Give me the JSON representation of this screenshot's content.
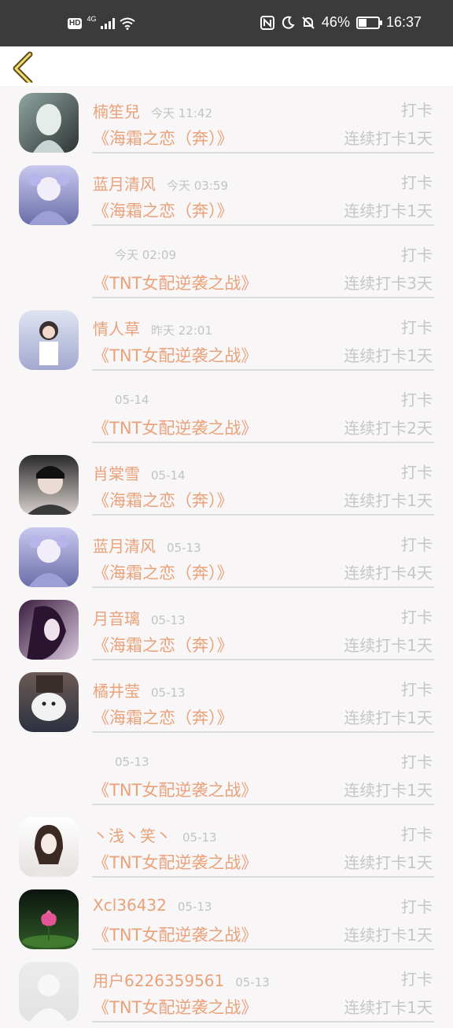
{
  "status_bar": {
    "hd": "HD",
    "network": "4G",
    "battery_percent": "46%",
    "battery_level": 0.46,
    "time": "16:37"
  },
  "header": {
    "back_icon": "chevron-left-icon"
  },
  "records": [
    {
      "name": "楠笙兒",
      "time": "今天 11:42",
      "action": "打卡",
      "book": "《海霜之恋（奔）》",
      "streak": "连续打卡1天",
      "avatar": "a1"
    },
    {
      "name": "蓝月清风",
      "time": "今天 03:59",
      "action": "打卡",
      "book": "《海霜之恋（奔）》",
      "streak": "连续打卡1天",
      "avatar": "a2"
    },
    {
      "name": "",
      "time": "今天 02:09",
      "action": "打卡",
      "book": "《TNT女配逆袭之战》",
      "streak": "连续打卡3天",
      "avatar": ""
    },
    {
      "name": "情人草",
      "time": "昨天 22:01",
      "action": "打卡",
      "book": "《TNT女配逆袭之战》",
      "streak": "连续打卡1天",
      "avatar": "a3"
    },
    {
      "name": "",
      "time": "05-14",
      "action": "打卡",
      "book": "《TNT女配逆袭之战》",
      "streak": "连续打卡2天",
      "avatar": ""
    },
    {
      "name": "肖棠雪",
      "time": "05-14",
      "action": "打卡",
      "book": "《海霜之恋（奔）》",
      "streak": "连续打卡1天",
      "avatar": "a4"
    },
    {
      "name": "蓝月清风",
      "time": "05-13",
      "action": "打卡",
      "book": "《海霜之恋（奔）》",
      "streak": "连续打卡4天",
      "avatar": "a2"
    },
    {
      "name": "月音璃",
      "time": "05-13",
      "action": "打卡",
      "book": "《海霜之恋（奔）》",
      "streak": "连续打卡1天",
      "avatar": "a5"
    },
    {
      "name": "橘井莹",
      "time": "05-13",
      "action": "打卡",
      "book": "《海霜之恋（奔）》",
      "streak": "连续打卡1天",
      "avatar": "a6"
    },
    {
      "name": "",
      "time": "05-13",
      "action": "打卡",
      "book": "《TNT女配逆袭之战》",
      "streak": "连续打卡1天",
      "avatar": ""
    },
    {
      "name": "丶浅丶笑丶",
      "time": "05-13",
      "action": "打卡",
      "book": "《TNT女配逆袭之战》",
      "streak": "连续打卡1天",
      "avatar": "a7"
    },
    {
      "name": "Xcl36432",
      "time": "05-13",
      "action": "打卡",
      "book": "《TNT女配逆袭之战》",
      "streak": "连续打卡1天",
      "avatar": "a8"
    },
    {
      "name": "用户6226359561",
      "time": "05-13",
      "action": "打卡",
      "book": "《TNT女配逆袭之战》",
      "streak": "连续打卡1天",
      "avatar": "a9"
    }
  ],
  "colors": {
    "accent": "#e9a27a",
    "muted": "#c6c6c6",
    "background": "#f8f6f7"
  }
}
